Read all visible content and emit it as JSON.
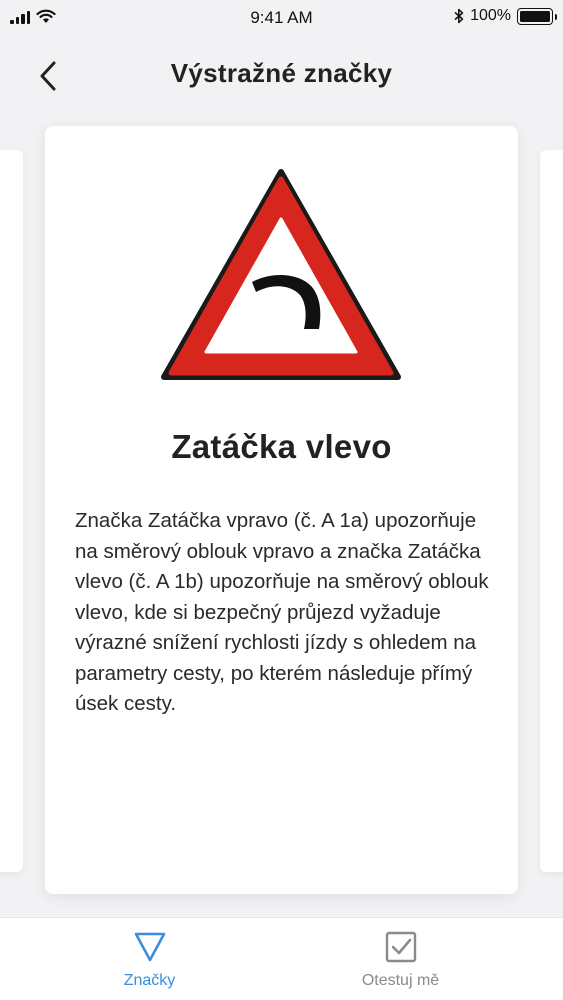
{
  "status_bar": {
    "time": "9:41 AM",
    "battery_text": "100%",
    "icons": [
      "signal-icon",
      "wifi-icon",
      "bluetooth-icon",
      "battery-icon"
    ]
  },
  "header": {
    "title": "Výstražné značky",
    "back_icon": "chevron-left-icon"
  },
  "card": {
    "sign_icon": "curve-left-warning-sign",
    "title": "Zatáčka vlevo",
    "description": "Značka Zatáčka vpravo (č. A 1a) upozorňuje na směrový oblouk vpravo a značka Zatáčka vlevo (č. A 1b) upozorňuje na směrový oblouk vlevo, kde si bezpečný průjezd vyžaduje výrazné snížení rychlosti jízdy s ohledem na parametry cesty, po kterém následuje přímý úsek cesty."
  },
  "tab_bar": {
    "tabs": [
      {
        "label": "Značky",
        "icon": "triangle-outline-icon",
        "active": true
      },
      {
        "label": "Otestuj mě",
        "icon": "checkbox-icon",
        "active": false
      }
    ]
  },
  "colors": {
    "accent": "#3a8ee0",
    "sign_red": "#d7261e",
    "background": "#f2f2f5"
  }
}
